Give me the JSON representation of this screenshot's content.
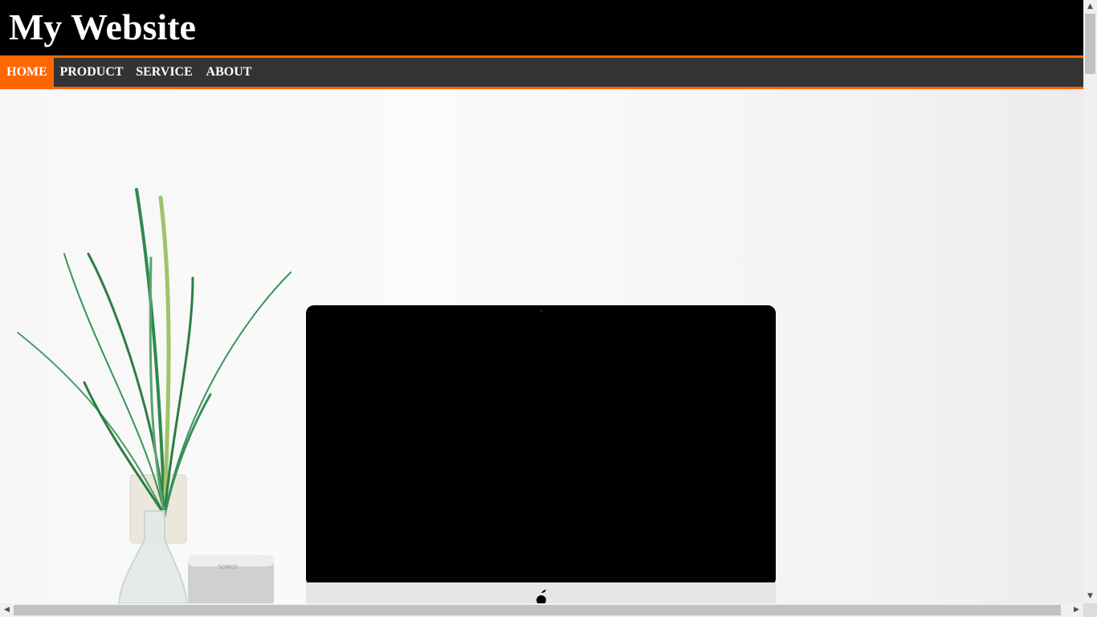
{
  "header": {
    "title": "My Website"
  },
  "nav": {
    "items": [
      {
        "label": "HOME",
        "active": true
      },
      {
        "label": "PRODUCT",
        "active": false
      },
      {
        "label": "SERVICE",
        "active": false
      },
      {
        "label": "ABOUT",
        "active": false
      }
    ]
  },
  "hero": {
    "image": "desk-with-plant-speaker-and-computer-monitor",
    "speaker_brand": "SONOS"
  },
  "colors": {
    "accent": "#ff6600",
    "header_bg": "#000000",
    "nav_bg": "#333333",
    "text": "#ffffff"
  },
  "scrollbars": {
    "vertical": {
      "up_icon": "▲",
      "down_icon": "▼"
    },
    "horizontal": {
      "left_icon": "◀",
      "right_icon": "▶"
    }
  }
}
